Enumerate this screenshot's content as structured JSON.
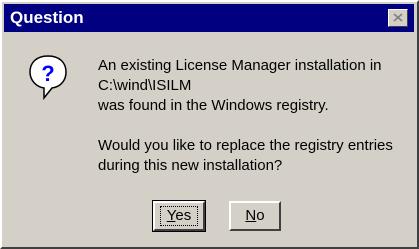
{
  "dialog": {
    "title": "Question",
    "close_icon": "close-icon",
    "question_icon": "question-icon",
    "message_lines": [
      "An existing License Manager installation in",
      "C:\\wind\\ISILM",
      "was found in the Windows registry."
    ],
    "question_lines": [
      "Would you like to replace the registry entries",
      "during this new installation?"
    ],
    "buttons": {
      "yes_mnemonic": "Y",
      "yes_rest": "es",
      "no_mnemonic": "N",
      "no_rest": "o"
    }
  },
  "colors": {
    "titlebar": "#000080",
    "face": "#d4d0c8",
    "icon_bubble": "#ffffff",
    "icon_mark": "#0000ff"
  }
}
